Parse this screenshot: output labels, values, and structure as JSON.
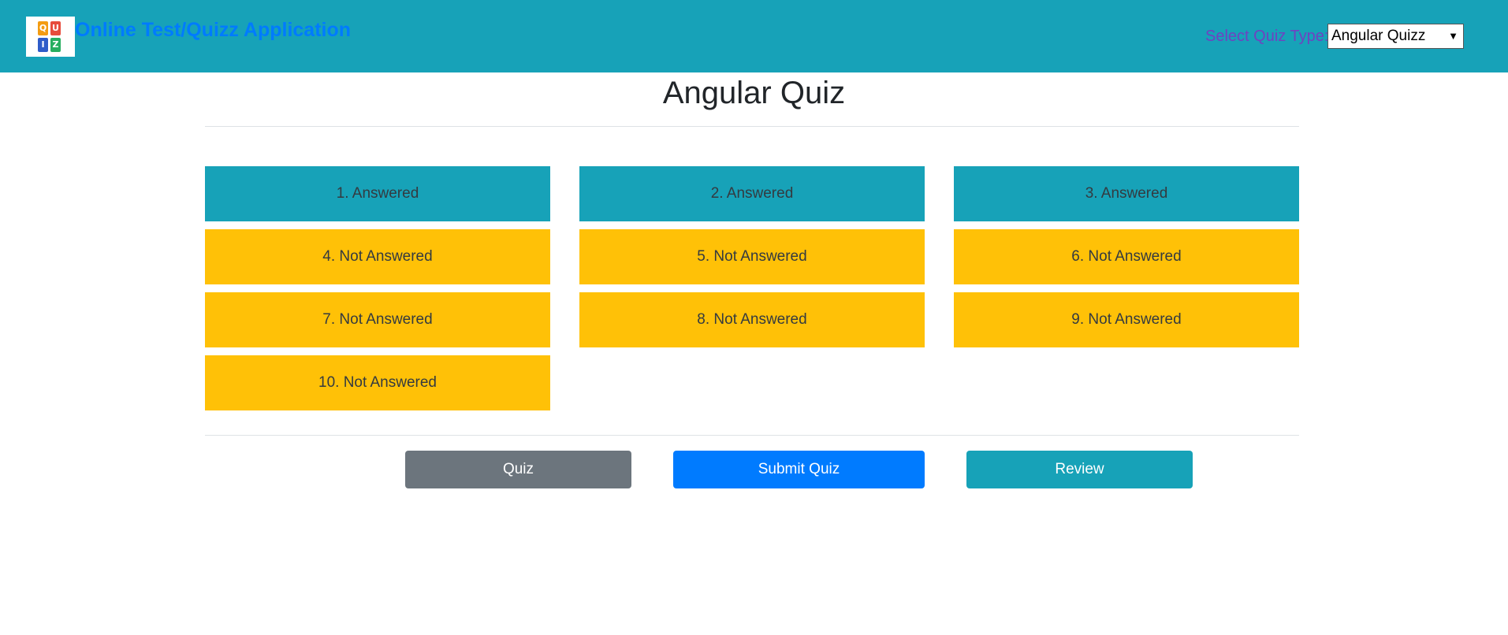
{
  "header": {
    "app_title": "Online Test/Quizz Application",
    "logo_letters": [
      "Q",
      "U",
      "I",
      "Z"
    ],
    "quiz_type_label": "Select Quiz Type:",
    "quiz_type_selected": "Angular Quizz"
  },
  "main": {
    "title": "Angular Quiz",
    "questions": [
      {
        "label": "1. Answered",
        "status": "answered"
      },
      {
        "label": "2. Answered",
        "status": "answered"
      },
      {
        "label": "3. Answered",
        "status": "answered"
      },
      {
        "label": "4. Not Answered",
        "status": "not-answered"
      },
      {
        "label": "5. Not Answered",
        "status": "not-answered"
      },
      {
        "label": "6. Not Answered",
        "status": "not-answered"
      },
      {
        "label": "7. Not Answered",
        "status": "not-answered"
      },
      {
        "label": "8. Not Answered",
        "status": "not-answered"
      },
      {
        "label": "9. Not Answered",
        "status": "not-answered"
      },
      {
        "label": "10. Not Answered",
        "status": "not-answered"
      }
    ]
  },
  "actions": {
    "quiz_label": "Quiz",
    "submit_label": "Submit Quiz",
    "review_label": "Review"
  },
  "colors": {
    "navbar": "#17a2b8",
    "answered": "#17a2b8",
    "not_answered": "#ffc107",
    "quiz_button": "#6c757d",
    "submit_button": "#007bff",
    "review_button": "#17a2b8"
  }
}
